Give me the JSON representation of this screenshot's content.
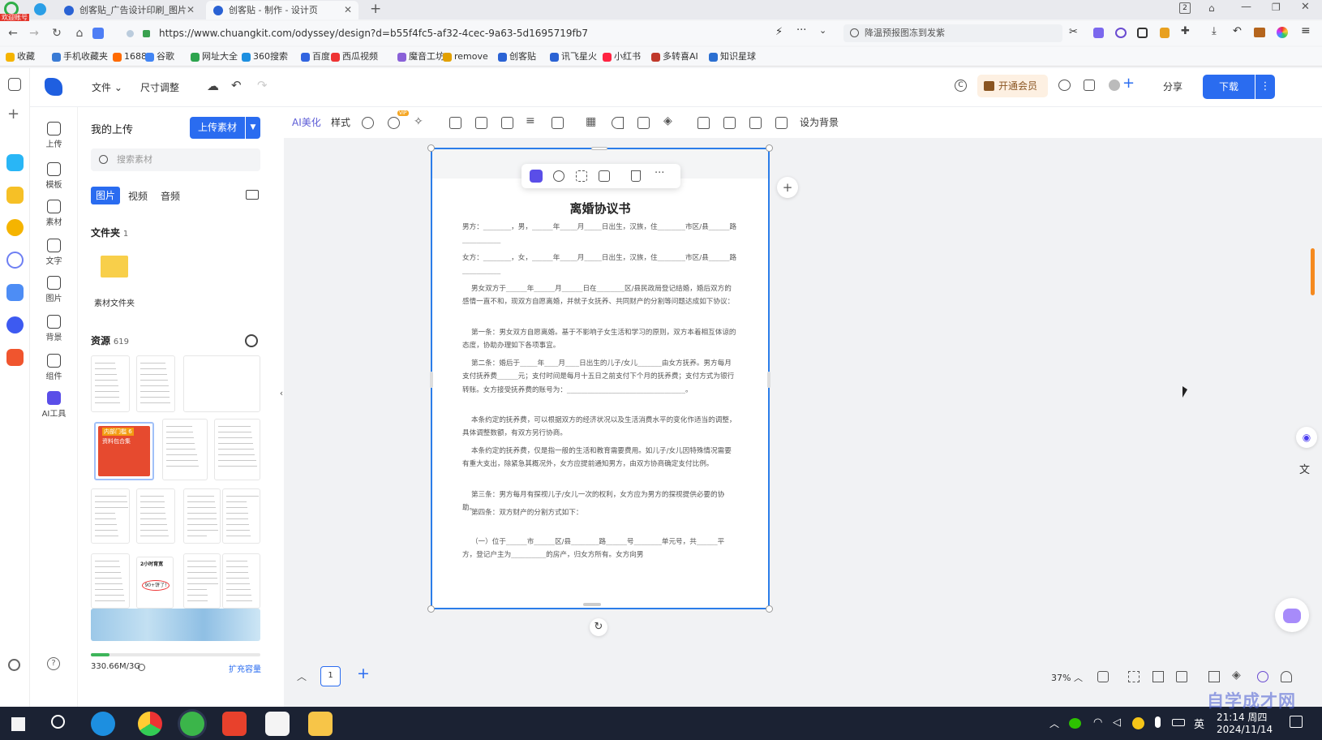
{
  "browser": {
    "tabs": [
      {
        "label": "创客贴_广告设计印刷_图片一"
      },
      {
        "label": "创客贴 - 制作 - 设计页"
      }
    ],
    "badge": "欢迎账号",
    "url": "https://www.chuangkit.com/odyssey/design?d=b55f4fc5-af32-4cec-9a63-5d1695719fb7",
    "search_text": "降温预报图冻到发紫",
    "tab_count": "2",
    "bookmarks": [
      "收藏",
      "手机收藏夹",
      "1688",
      "谷歌",
      "网址大全",
      "360搜索",
      "百度",
      "西瓜视频",
      "魔音工坊",
      "remove",
      "创客贴",
      "讯飞星火",
      "小红书",
      "多转喜AI",
      "知识星球"
    ]
  },
  "app": {
    "menu": {
      "file": "文件",
      "resize": "尺寸调整"
    },
    "actions": {
      "vip": "开通会员",
      "share": "分享",
      "download": "下载"
    },
    "rail": [
      {
        "label": "上传"
      },
      {
        "label": "模板"
      },
      {
        "label": "素材"
      },
      {
        "label": "文字"
      },
      {
        "label": "图片"
      },
      {
        "label": "背景"
      },
      {
        "label": "组件"
      },
      {
        "label": "AI工具"
      }
    ],
    "panel": {
      "title": "我的上传",
      "upload_button": "上传素材",
      "search_placeholder": "搜索素材",
      "tabs": [
        "图片",
        "视频",
        "音频"
      ],
      "folder_heading": "文件夹",
      "folder_count": "1",
      "folder_name": "素材文件夹",
      "resources_heading": "资源",
      "resources_count": "619",
      "storage": "330.66M/3G",
      "storage_fraction": 0.108,
      "expand": "扩充容量",
      "thumb_red_title": "内部门槛 6",
      "thumb_red_sub": "资料包合集",
      "thumb_oval_title": "2小时育宽",
      "thumb_oval_sub": "90+饼了!"
    },
    "toolbar": {
      "ai": "AI美化",
      "style": "样式",
      "set_bg": "设为背景",
      "badge": "VIP"
    },
    "doc": {
      "title": "离婚协议书",
      "paragraphs": [
        "男方：________，男，______年_____月_____日出生，汉族，住________市区/县______路___________",
        "女方：________，女，______年_____月_____日出生，汉族，住________市区/县______路___________",
        "    男女双方于______年______月______日在________区/县民政局登记结婚，婚后双方的感情一直不和，现双方自愿离婚，并就子女抚养、共同财产的分割等问题达成如下协议：",
        "    第一条：男女双方自愿离婚。基于不影响子女生活和学习的原则，双方本着相互体谅的态度，协助办理如下各项事宜。",
        "    第二条：婚后于_____年____月____日出生的儿子/女儿_______由女方抚养。男方每月支付抚养费______元；支付时间是每月十五日之前支付下个月的抚养费；支付方式为银行转账。女方接受抚养费的账号为：__________________________________。",
        "    本条约定的抚养费，可以根据双方的经济状况以及生活消费水平的变化作适当的调整，具体调整数额，有双方另行协商。",
        "    本条约定的抚养费，仅是指一般的生活和教育需要费用。如儿子/女儿因特殊情况需要有重大支出，除紧急其概况外，女方应提前通知男方，由双方协商确定支付比例。",
        "    第三条：男方每月有探视儿子/女儿一次的权利，女方应为男方的探视提供必要的协助。",
        "    第四条：双方财产的分割方式如下：",
        "    （一）位于______市______区/县________路______号________单元号，共______平方，登记户主为__________的房产，归女方所有。女方向男"
      ]
    },
    "status": {
      "page": "1",
      "zoom": "37%"
    }
  },
  "taskbar": {
    "time": "21:14 周四",
    "date": "2024/11/14",
    "ime": "英"
  },
  "watermark": "自学成才网"
}
